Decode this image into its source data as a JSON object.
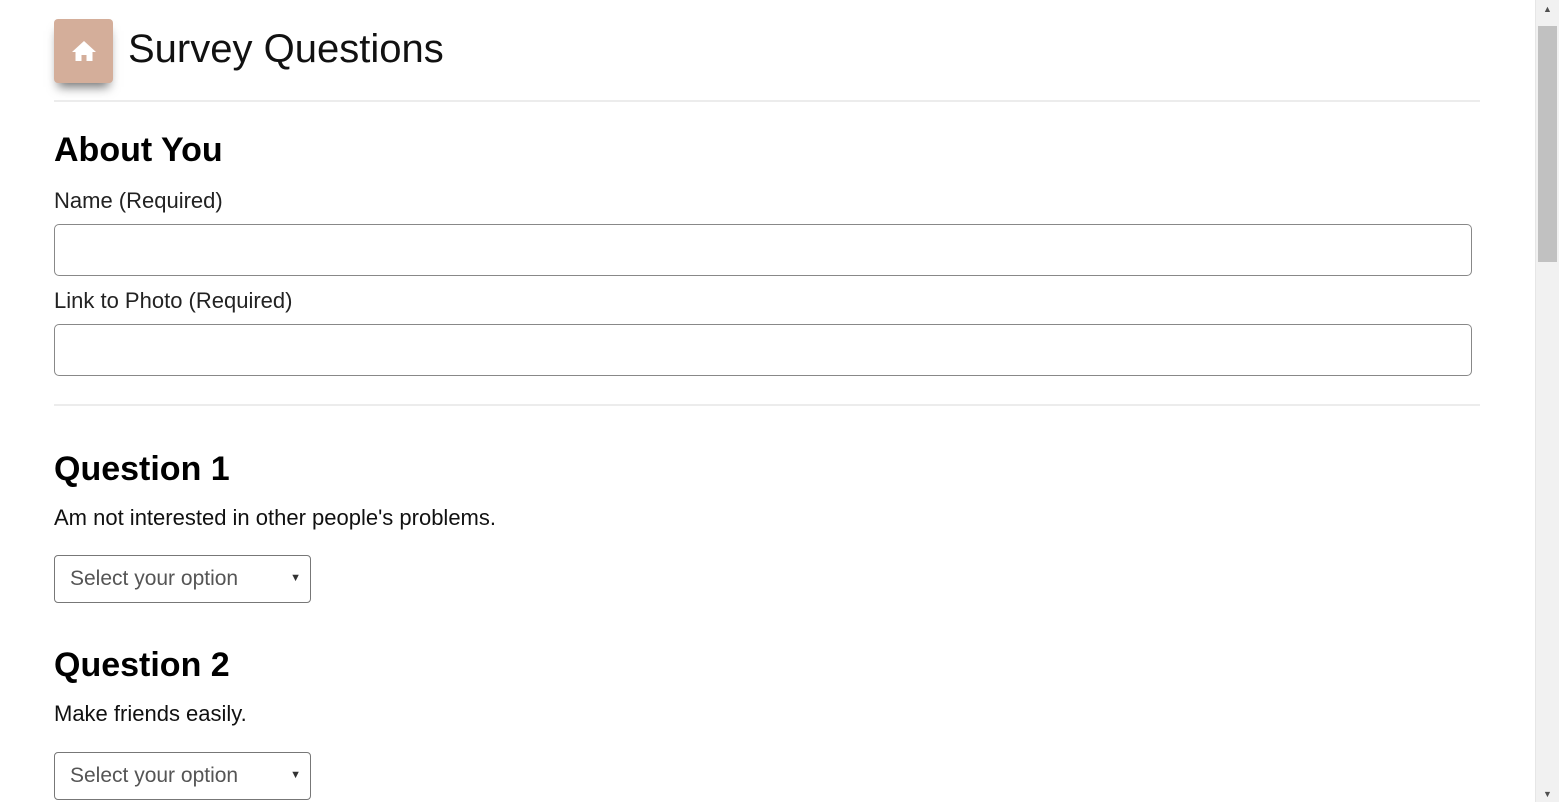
{
  "header": {
    "home_icon": "home-icon",
    "title": "Survey Questions",
    "accent_color": "#d4ae9a"
  },
  "about": {
    "title": "About You",
    "name_label": "Name (Required)",
    "name_value": "",
    "photo_label": "Link to Photo (Required)",
    "photo_value": ""
  },
  "questions": [
    {
      "title": "Question 1",
      "text": "Am not interested in other people's problems.",
      "selected": "Select your option"
    },
    {
      "title": "Question 2",
      "text": "Make friends easily.",
      "selected": "Select your option"
    }
  ],
  "scrollbar": {
    "up_icon": "scroll-up-arrow-icon",
    "down_icon": "scroll-down-arrow-icon"
  }
}
